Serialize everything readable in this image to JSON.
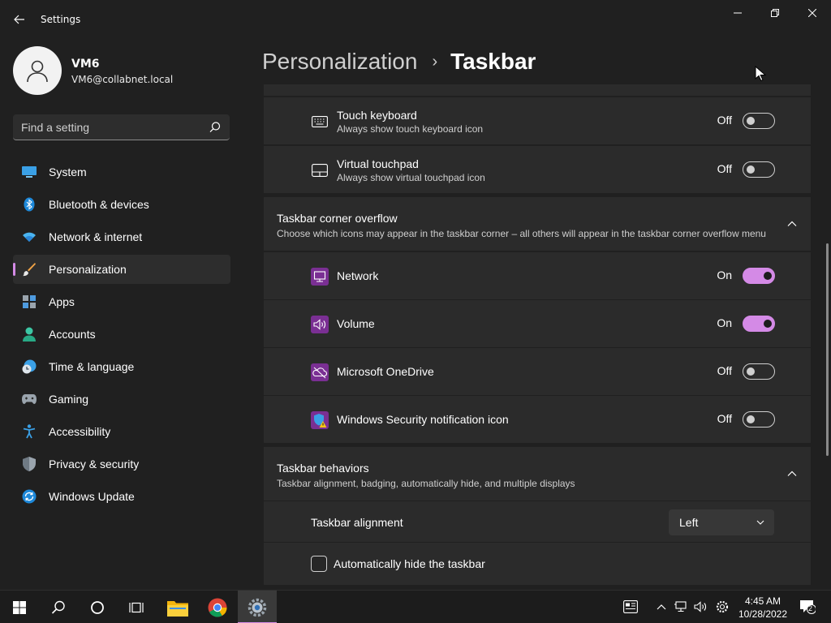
{
  "window": {
    "title": "Settings"
  },
  "profile": {
    "name": "VM6",
    "email": "VM6@collabnet.local"
  },
  "search": {
    "placeholder": "Find a setting"
  },
  "nav": {
    "items": [
      {
        "label": "System",
        "icon": "system-icon",
        "active": false
      },
      {
        "label": "Bluetooth & devices",
        "icon": "bluetooth-icon",
        "active": false
      },
      {
        "label": "Network & internet",
        "icon": "wifi-icon",
        "active": false
      },
      {
        "label": "Personalization",
        "icon": "brush-icon",
        "active": true
      },
      {
        "label": "Apps",
        "icon": "apps-icon",
        "active": false
      },
      {
        "label": "Accounts",
        "icon": "person-icon",
        "active": false
      },
      {
        "label": "Time & language",
        "icon": "clock-globe-icon",
        "active": false
      },
      {
        "label": "Gaming",
        "icon": "gamepad-icon",
        "active": false
      },
      {
        "label": "Accessibility",
        "icon": "accessibility-icon",
        "active": false
      },
      {
        "label": "Privacy & security",
        "icon": "shield-icon",
        "active": false
      },
      {
        "label": "Windows Update",
        "icon": "update-icon",
        "active": false
      }
    ]
  },
  "header": {
    "parent": "Personalization",
    "separator": "›",
    "current": "Taskbar"
  },
  "pen_row": {
    "touch_keyboard": {
      "title": "Touch keyboard",
      "subtitle": "Always show touch keyboard icon",
      "state": "Off"
    },
    "virtual_touchpad": {
      "title": "Virtual touchpad",
      "subtitle": "Always show virtual touchpad icon",
      "state": "Off"
    }
  },
  "corner_overflow": {
    "title": "Taskbar corner overflow",
    "subtitle": "Choose which icons may appear in the taskbar corner – all others will appear in the taskbar corner overflow menu",
    "items": {
      "network": {
        "title": "Network",
        "state": "On"
      },
      "volume": {
        "title": "Volume",
        "state": "On"
      },
      "onedrive": {
        "title": "Microsoft OneDrive",
        "state": "Off"
      },
      "security": {
        "title": "Windows Security notification icon",
        "state": "Off"
      }
    }
  },
  "behaviors": {
    "title": "Taskbar behaviors",
    "subtitle": "Taskbar alignment, badging, automatically hide, and multiple displays",
    "alignment_label": "Taskbar alignment",
    "alignment_value": "Left",
    "autohide_label": "Automatically hide the taskbar",
    "autohide_checked": false
  },
  "taskbar": {
    "time": "4:45 AM",
    "date": "10/28/2022",
    "notification_count": "2"
  },
  "colors": {
    "accent": "#d48ae6",
    "background": "#202020",
    "card": "#2b2b2b"
  }
}
